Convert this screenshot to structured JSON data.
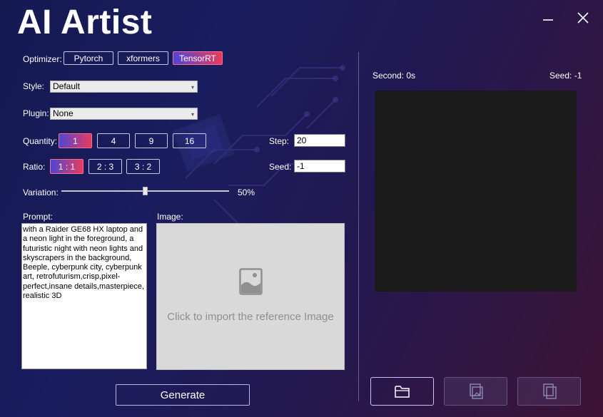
{
  "app": {
    "title": "AI Artist"
  },
  "window": {
    "minimize_icon": "minimize-icon",
    "close_icon": "close-icon"
  },
  "optimizer": {
    "label": "Optimizer:",
    "options": [
      "Pytorch",
      "xformers",
      "TensorRT"
    ],
    "selected": "TensorRT"
  },
  "style": {
    "label": "Style:",
    "value": "Default"
  },
  "plugin": {
    "label": "Plugin:",
    "value": "None"
  },
  "quantity": {
    "label": "Quantity:",
    "options": [
      "1",
      "4",
      "9",
      "16"
    ],
    "selected": "1"
  },
  "ratio": {
    "label": "Ratio:",
    "options": [
      "1 : 1",
      "2 : 3",
      "3 : 2"
    ],
    "selected": "1 : 1"
  },
  "step": {
    "label": "Step:",
    "value": "20"
  },
  "seed": {
    "label": "Seed:",
    "value": "-1"
  },
  "variation": {
    "label": "Variation:",
    "value": 50,
    "display": "50%"
  },
  "prompt": {
    "label": "Prompt:",
    "text": "with a Raider GE68 HX laptop and a neon light in the foreground, a futuristic night with neon lights and skyscrapers in the background, Beeple, cyberpunk city, cyberpunk art, retrofuturism,crisp,pixel-perfect,insane details,masterpiece, realistic 3D"
  },
  "image": {
    "label": "Image:",
    "placeholder": "Click to import the reference Image",
    "icon": "image-icon"
  },
  "generate": {
    "label": "Generate"
  },
  "output": {
    "second_label": "Second: 0s",
    "seed_label": "Seed: -1"
  },
  "bottom_actions": [
    {
      "icon": "folder-icon",
      "enabled": true
    },
    {
      "icon": "image-copy-icon",
      "enabled": false
    },
    {
      "icon": "copy-icon",
      "enabled": false
    }
  ],
  "colors": {
    "accent_start": "#4d46d6",
    "accent_end": "#ea3b5d",
    "preview_bg": "#1a1a1a",
    "drop_bg": "#d9d9d9"
  }
}
